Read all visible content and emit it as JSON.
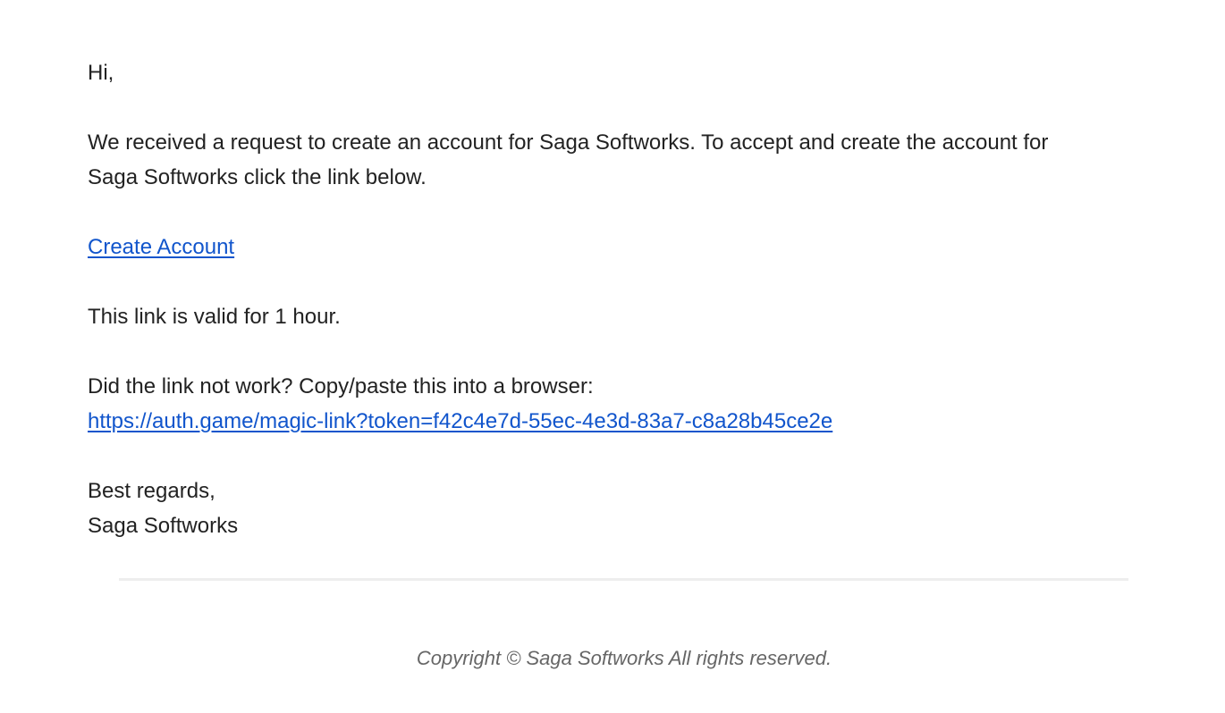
{
  "email": {
    "greeting": "Hi,",
    "intro_line1": "We received a request to create an account for Saga Softworks. To accept and create the account for",
    "intro_line2": "Saga Softworks click the link below.",
    "create_link_label": "Create Account",
    "validity_text": "This link is valid for 1 hour.",
    "fallback_text": "Did the link not work? Copy/paste this into a browser:",
    "magic_link_url": "https://auth.game/magic-link?token=f42c4e7d-55ec-4e3d-83a7-c8a28b45ce2e",
    "signoff": "Best regards,",
    "signature": "Saga Softworks"
  },
  "footer": {
    "copyright": "Copyright © Saga Softworks All rights reserved."
  },
  "colors": {
    "text": "#222222",
    "link": "#1155cc",
    "footer_text": "#666666",
    "divider": "#eeeeee"
  }
}
